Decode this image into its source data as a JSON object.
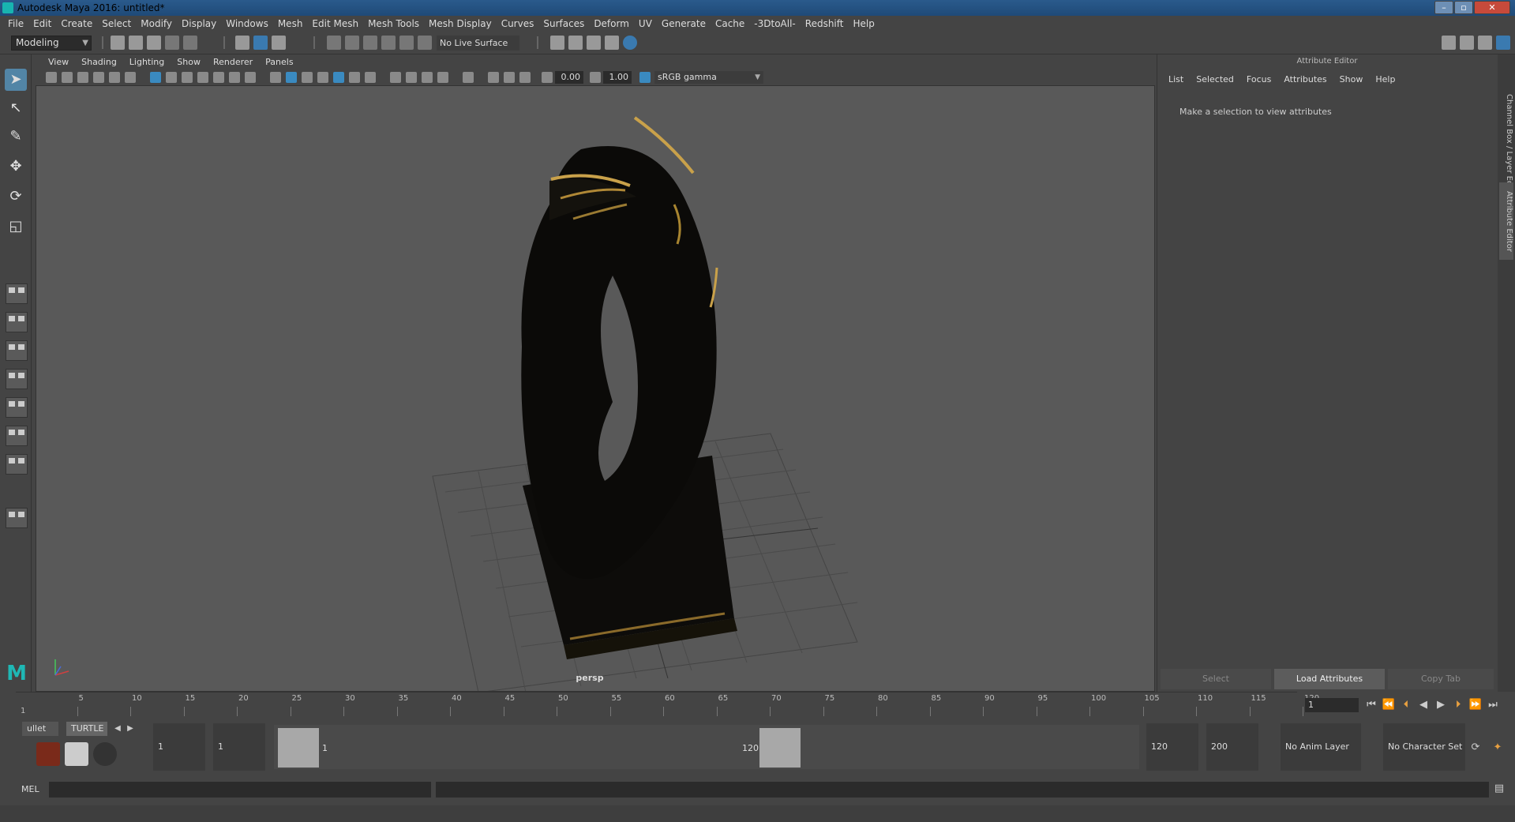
{
  "window": {
    "title": "Autodesk Maya 2016: untitled*",
    "min": "–",
    "max": "▫",
    "close": "✕"
  },
  "menubar": [
    "File",
    "Edit",
    "Create",
    "Select",
    "Modify",
    "Display",
    "Windows",
    "Mesh",
    "Edit Mesh",
    "Mesh Tools",
    "Mesh Display",
    "Curves",
    "Surfaces",
    "Deform",
    "UV",
    "Generate",
    "Cache",
    "-3DtoAll-",
    "Redshift",
    "Help"
  ],
  "statusline": {
    "mode": "Modeling",
    "live_surface": "No Live Surface"
  },
  "panel": {
    "menu": [
      "View",
      "Shading",
      "Lighting",
      "Show",
      "Renderer",
      "Panels"
    ],
    "exposure": "0.00",
    "gamma": "1.00",
    "colorspace": "sRGB gamma",
    "camera": "persp"
  },
  "attribute_editor": {
    "title": "Attribute Editor",
    "menu": [
      "List",
      "Selected",
      "Focus",
      "Attributes",
      "Show",
      "Help"
    ],
    "message": "Make a selection to view attributes",
    "buttons": {
      "select": "Select",
      "load": "Load Attributes",
      "copy": "Copy Tab"
    },
    "side_tabs": {
      "channel": "Channel Box / Layer Editor",
      "attr": "Attribute Editor"
    }
  },
  "timeslider": {
    "ticks": [
      "5",
      "10",
      "15",
      "20",
      "25",
      "30",
      "35",
      "40",
      "45",
      "50",
      "55",
      "60",
      "65",
      "70",
      "75",
      "80",
      "85",
      "90",
      "95",
      "100",
      "105",
      "110",
      "115",
      "120"
    ],
    "start_label": "1",
    "current_frame": "1"
  },
  "shelf": {
    "tab_bullet": "ullet",
    "tab_turtle": "TURTLE"
  },
  "range": {
    "start": "1",
    "playback_start": "1",
    "handle_start": "1",
    "handle_end": "120",
    "playback_end": "120",
    "end": "200",
    "anim_layer": "No Anim Layer",
    "character_set": "No Character Set"
  },
  "cmdline": {
    "label": "MEL"
  },
  "colors": {
    "accent": "#5285a6",
    "viewport": "#595959",
    "maya_teal": "#1fb8b5"
  }
}
